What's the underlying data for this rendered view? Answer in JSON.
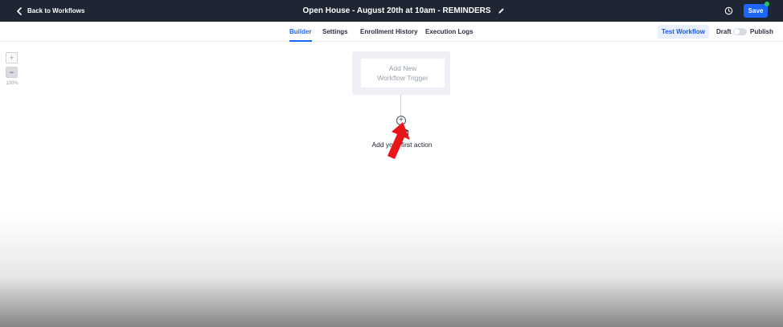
{
  "topbar": {
    "back_label": "Back to Workflows",
    "workflow_title": "Open House - August 20th at 10am - REMINDERS",
    "save_label": "Save"
  },
  "subnav": {
    "tabs": [
      {
        "label": "Builder",
        "active": true
      },
      {
        "label": "Settings",
        "active": false
      },
      {
        "label": "Enrollment History",
        "active": false
      },
      {
        "label": "Execution Logs",
        "active": false
      }
    ],
    "test_workflow_label": "Test Workflow",
    "draft_label": "Draft",
    "publish_label": "Publish",
    "published": false
  },
  "zoom": {
    "in_label": "+",
    "out_label": "−",
    "level": "100%"
  },
  "canvas": {
    "trigger_line1": "Add New",
    "trigger_line2": "Workflow Trigger",
    "add_action_symbol": "+",
    "add_first_action_label": "Add your first action"
  },
  "colors": {
    "topbar_bg": "#1e2633",
    "accent": "#1a66ff",
    "status_dot": "#22c55e",
    "annotation_arrow": "#e8151b"
  },
  "icons": {
    "back": "chevron-left-icon",
    "edit": "pencil-icon",
    "history": "history-icon",
    "cursor": "hand-pointer-icon",
    "annotation": "red-arrow-icon"
  }
}
